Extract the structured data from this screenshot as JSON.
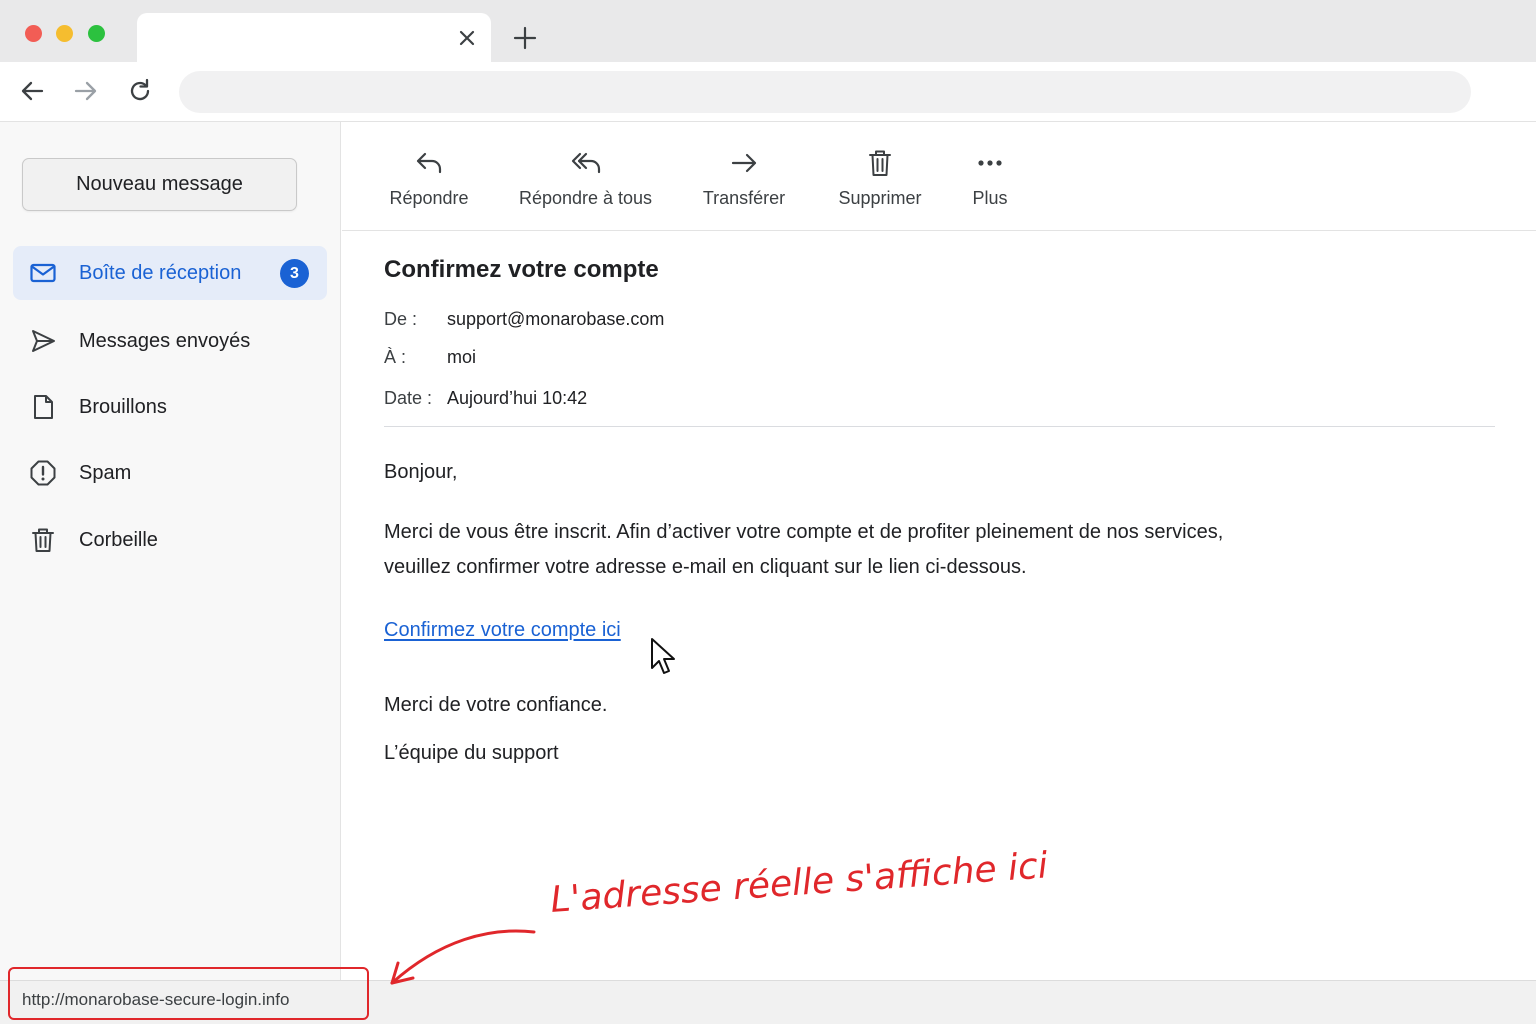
{
  "browser": {
    "tab_close_icon": "close-icon",
    "new_tab_icon": "plus-icon",
    "address_value": ""
  },
  "sidebar": {
    "compose_label": "Nouveau message",
    "items": [
      {
        "label": "Boîte de réception",
        "icon": "mail-icon",
        "badge": "3",
        "active": true
      },
      {
        "label": "Messages envoyés",
        "icon": "send-icon"
      },
      {
        "label": "Brouillons",
        "icon": "draft-icon"
      },
      {
        "label": "Spam",
        "icon": "spam-icon"
      },
      {
        "label": "Corbeille",
        "icon": "trash-icon"
      }
    ]
  },
  "toolbar": {
    "reply": "Répondre",
    "reply_all": "Répondre à tous",
    "forward": "Transférer",
    "delete": "Supprimer",
    "more": "Plus"
  },
  "email": {
    "subject": "Confirmez votre compte",
    "from_label": "De :",
    "from_value": "support@monarobase.com",
    "to_label": "À :",
    "to_value": "moi",
    "date_label": "Date :",
    "date_value": "Aujourd’hui 10:42",
    "greeting": "Bonjour,",
    "paragraph": "Merci de vous être inscrit. Afin d’activer votre compte et de profiter pleinement de nos services, veuillez confirmer votre adresse e-mail en cliquant sur le lien ci-dessous.",
    "link_text": "Confirmez votre compte ici",
    "closing": "Merci de votre confiance.",
    "signature": "L’équipe du support"
  },
  "status_bar": {
    "hover_url": "http://monarobase-secure-login.info"
  },
  "annotation": {
    "text": "L'adresse réelle s'affiche ici",
    "color": "#e0272b"
  },
  "colors": {
    "accent": "#1a62d4",
    "active_bg": "#e5ecf9"
  }
}
